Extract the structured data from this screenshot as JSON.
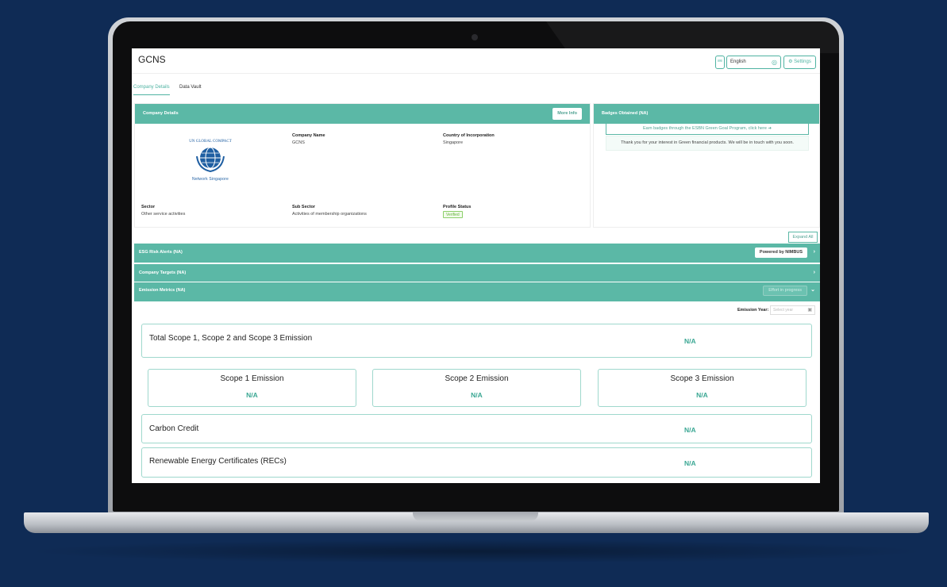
{
  "app": {
    "title": "GCNS"
  },
  "header": {
    "language": "English",
    "settings_label": "⚙ Settings"
  },
  "tabs": [
    {
      "label": "Company Details"
    },
    {
      "label": "Data Vault"
    }
  ],
  "company_details": {
    "heading": "Company Details",
    "more_info_label": "More Info",
    "logo_lettering": "UN GLOBAL COMPACT",
    "logo_caption": "Network Singapore",
    "fields": {
      "company_name": {
        "label": "Company Name",
        "value": "GCNS"
      },
      "country": {
        "label": "Country of Incorporation",
        "value": "Singapore"
      },
      "sector": {
        "label": "Sector",
        "value": "Other service activities"
      },
      "sub_sector": {
        "label": "Sub Sector",
        "value": "Activities of membership organizations"
      },
      "profile_status": {
        "label": "Profile Status",
        "value": "Verified"
      }
    }
  },
  "badges": {
    "heading": "Badges Obtained (NA)",
    "earn_link": "Earn badges through the ESBN Green Goal Program, click here ➔",
    "thanks_message": "Thank you for your interest in Green financial products. We will be in touch with you soon."
  },
  "expand_all_label": "Expand All",
  "sections": {
    "esg": {
      "label": "ESG Risk Alerts (NA)",
      "button": "Powered by NIMBUS"
    },
    "targets": {
      "label": "Company Targets (NA)"
    },
    "emission": {
      "label": "Emission Metrics (NA)",
      "button": "Effort in progress"
    }
  },
  "emission_year": {
    "label": "Emission Year:",
    "placeholder": "Select year"
  },
  "emissions": {
    "total": {
      "label": "Total Scope 1, Scope 2 and Scope 3 Emission",
      "value": "N/A"
    },
    "scope1": {
      "label": "Scope 1 Emission",
      "value": "N/A"
    },
    "scope2": {
      "label": "Scope 2 Emission",
      "value": "N/A"
    },
    "scope3": {
      "label": "Scope 3 Emission",
      "value": "N/A"
    },
    "carbon_credit": {
      "label": "Carbon Credit",
      "value": "N/A"
    },
    "recs": {
      "label": "Renewable Energy Certificates (RECs)",
      "value": "N/A"
    }
  },
  "colors": {
    "accent": "#5bb8a6",
    "accent_text": "#3aa793",
    "background": "#0f2b55"
  }
}
